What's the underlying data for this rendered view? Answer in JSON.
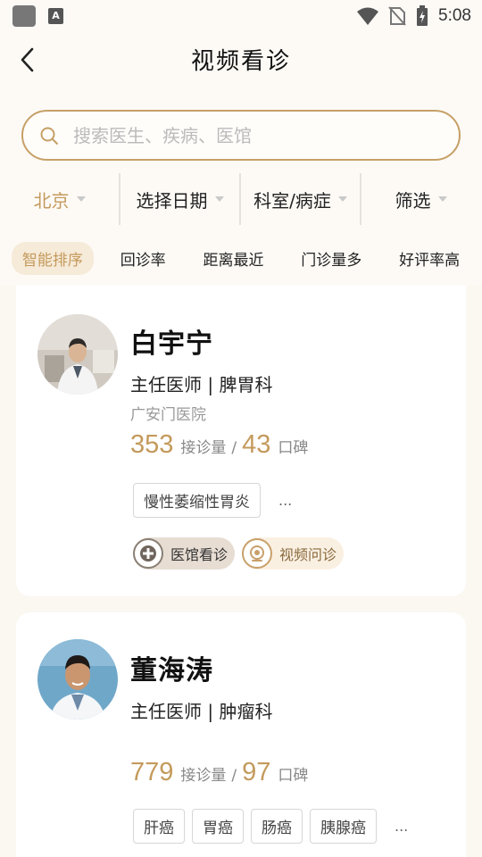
{
  "status_bar": {
    "time": "5:08",
    "icons": [
      "app-icon",
      "notification-a-icon",
      "wifi-icon",
      "no-sim-icon",
      "battery-charging-icon"
    ],
    "notification_letter": "A"
  },
  "header": {
    "title": "视频看诊",
    "back_icon": "chevron-left-icon"
  },
  "search": {
    "placeholder": "搜索医生、疾病、医馆",
    "value": ""
  },
  "filters": [
    {
      "label": "北京",
      "active": true
    },
    {
      "label": "选择日期",
      "active": false
    },
    {
      "label": "科室/病症",
      "active": false
    },
    {
      "label": "筛选",
      "active": false
    }
  ],
  "sort": [
    {
      "label": "智能排序",
      "active": true
    },
    {
      "label": "回诊率",
      "active": false
    },
    {
      "label": "距离最近",
      "active": false
    },
    {
      "label": "门诊量多",
      "active": false
    },
    {
      "label": "好评率高",
      "active": false
    }
  ],
  "doctors": [
    {
      "name": "白宇宁",
      "title": "主任医师 | 脾胃科",
      "hospital": "广安门医院",
      "consultations": "353",
      "consult_label": "接诊量",
      "separator": "/",
      "reputation": "43",
      "reputation_label": "口碑",
      "tags": [
        "慢性萎缩性胃炎"
      ],
      "more": "...",
      "services": [
        {
          "label": "医馆看诊",
          "icon": "clinic-plus-icon"
        },
        {
          "label": "视频问诊",
          "icon": "webcam-icon"
        }
      ]
    },
    {
      "name": "董海涛",
      "title": "主任医师 | 肿瘤科",
      "hospital": "",
      "consultations": "779",
      "consult_label": "接诊量",
      "separator": "/",
      "reputation": "97",
      "reputation_label": "口碑",
      "tags": [
        "肝癌",
        "胃癌",
        "肠癌",
        "胰腺癌"
      ],
      "more": "..."
    }
  ],
  "colors": {
    "accent": "#c49a5c",
    "page_bg": "#fbf7f1",
    "card_bg": "#ffffff",
    "search_border": "#c6a067"
  }
}
